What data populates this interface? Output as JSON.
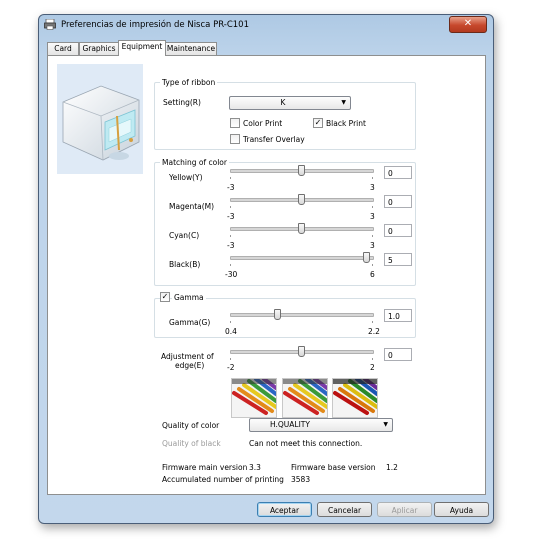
{
  "window": {
    "title": "Preferencias de impresión de Nisca PR-C101",
    "close_glyph": "✕"
  },
  "tabs": [
    {
      "label": "Card"
    },
    {
      "label": "Graphics"
    },
    {
      "label": "Equipment"
    },
    {
      "label": "Maintenance"
    }
  ],
  "ribbon": {
    "group_title": "Type of ribbon",
    "setting_label": "Setting(R)",
    "setting_value": "K",
    "color_print_label": "Color Print",
    "color_print_checked": false,
    "black_print_label": "Black Print",
    "black_print_checked": true,
    "transfer_overlay_label": "Transfer Overlay",
    "transfer_overlay_checked": false
  },
  "matching": {
    "group_title": "Matching of color",
    "sliders": [
      {
        "label": "Yellow(Y)",
        "min": "-3",
        "max": "3",
        "value": "0"
      },
      {
        "label": "Magenta(M)",
        "min": "-3",
        "max": "3",
        "value": "0"
      },
      {
        "label": "Cyan(C)",
        "min": "-3",
        "max": "3",
        "value": "0"
      },
      {
        "label": "Black(B)",
        "min": "-30",
        "max": "6",
        "value": "5"
      }
    ]
  },
  "gamma": {
    "checkbox_label": "Gamma",
    "checked": true,
    "label": "Gamma(G)",
    "min": "0.4",
    "max": "2.2",
    "value": "1.0"
  },
  "edge": {
    "label_line1": "Adjustment of",
    "label_line2": "edge(E)",
    "min": "-2",
    "max": "2",
    "value": "0"
  },
  "quality": {
    "label": "Quality of color",
    "value": "H.QUALITY",
    "black_label": "Quality of black",
    "black_note": "Can not meet this connection."
  },
  "info": {
    "fw_main_label": "Firmware main version",
    "fw_main_value": "3.3",
    "fw_base_label": "Firmware base version",
    "fw_base_value": "1.2",
    "accum_label": "Accumulated number of printing",
    "accum_value": "3583"
  },
  "buttons": {
    "ok": "Aceptar",
    "cancel": "Cancelar",
    "apply": "Aplicar",
    "help": "Ayuda"
  },
  "colors": {
    "title_bar": "#aec9e4",
    "close_button": "#c7482c",
    "default_button_border": "#3c7fb1"
  }
}
